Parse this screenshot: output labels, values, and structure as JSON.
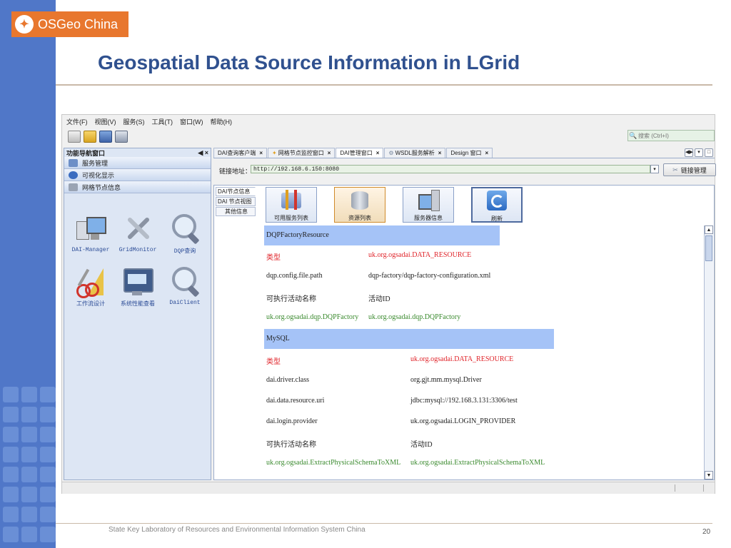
{
  "slide": {
    "logo_text": "OSGeo China",
    "title": "Geospatial Data Source Information in LGrid",
    "footer": "State Key Laboratory of Resources and Environmental Information System China",
    "page_number": "20"
  },
  "app": {
    "menu": [
      "文件(F)",
      "视图(V)",
      "服务(S)",
      "工具(T)",
      "窗口(W)",
      "帮助(H)"
    ],
    "toolbar_icons": [
      "new-file-icon",
      "open-folder-icon",
      "deploy-icon",
      "network-icon"
    ],
    "search_placeholder": "搜索 (Ctrl+I)",
    "nav": {
      "title": "功能导航窗口",
      "controls": "◀ ×",
      "items": [
        "服务管理",
        "可视化显示",
        "网格节点信息"
      ],
      "tools": [
        {
          "label": "DAI-Manager",
          "icon": "computer-network-icon"
        },
        {
          "label": "GridMonitor",
          "icon": "tools-icon"
        },
        {
          "label": "DQP查询",
          "icon": "magnifier-icon"
        },
        {
          "label": "工作流设计",
          "icon": "scissors-ruler-icon"
        },
        {
          "label": "系统性能查看",
          "icon": "performance-monitor-icon"
        },
        {
          "label": "DaiClient",
          "icon": "magnifier-icon"
        }
      ]
    },
    "tabs": [
      {
        "label": "DAI查询客户端",
        "active": false
      },
      {
        "label": "网格节点监控窗口",
        "active": false
      },
      {
        "label": "DAI管理窗口",
        "active": true
      },
      {
        "label": "WSDL服务解析",
        "active": false
      },
      {
        "label": "Design 窗口",
        "active": false
      }
    ],
    "link_label": "链接地址：",
    "link_url": "http://192.168.6.150:8080",
    "link_button": "链接管理",
    "subtabs": [
      "DAI节点信息",
      "DAI 节点视图",
      "其他信息"
    ],
    "actions": [
      {
        "label": "可用服务列表",
        "icon": "services-icon"
      },
      {
        "label": "资源列表",
        "icon": "database-icon"
      },
      {
        "label": "服务器信息",
        "icon": "server-icon"
      },
      {
        "label": "刷新",
        "icon": "refresh-icon"
      }
    ],
    "resources": [
      {
        "name": "DQPFactoryResource",
        "props": [
          {
            "key": "类型",
            "value": "uk.org.ogsadai.DATA_RESOURCE",
            "color": "red"
          },
          {
            "key": "dqp.config.file.path",
            "value": "dqp-factory/dqp-factory-configuration.xml",
            "color": "dark"
          },
          {
            "key": "可执行活动名称",
            "value": "活动ID",
            "color": "dark"
          },
          {
            "key": "uk.org.ogsadai.dqp.DQPFactory",
            "value": "uk.org.ogsadai.dqp.DQPFactory",
            "color": "green"
          }
        ]
      },
      {
        "name": "MySQL",
        "props": [
          {
            "key": "类型",
            "value": "uk.org.ogsadai.DATA_RESOURCE",
            "color": "red"
          },
          {
            "key": "dai.driver.class",
            "value": "org.gjt.mm.mysql.Driver",
            "color": "dark"
          },
          {
            "key": "dai.data.resource.uri",
            "value": "jdbc:mysql://192.168.3.131:3306/test",
            "color": "dark"
          },
          {
            "key": "dai.login.provider",
            "value": "uk.org.ogsadai.LOGIN_PROVIDER",
            "color": "dark"
          },
          {
            "key": "可执行活动名称",
            "value": "活动ID",
            "color": "dark"
          },
          {
            "key": "uk.org.ogsadai.ExtractPhysicalSchemaToXML",
            "value": "uk.org.ogsadai.ExtractPhysicalSchemaToXML",
            "color": "green"
          }
        ]
      }
    ]
  }
}
